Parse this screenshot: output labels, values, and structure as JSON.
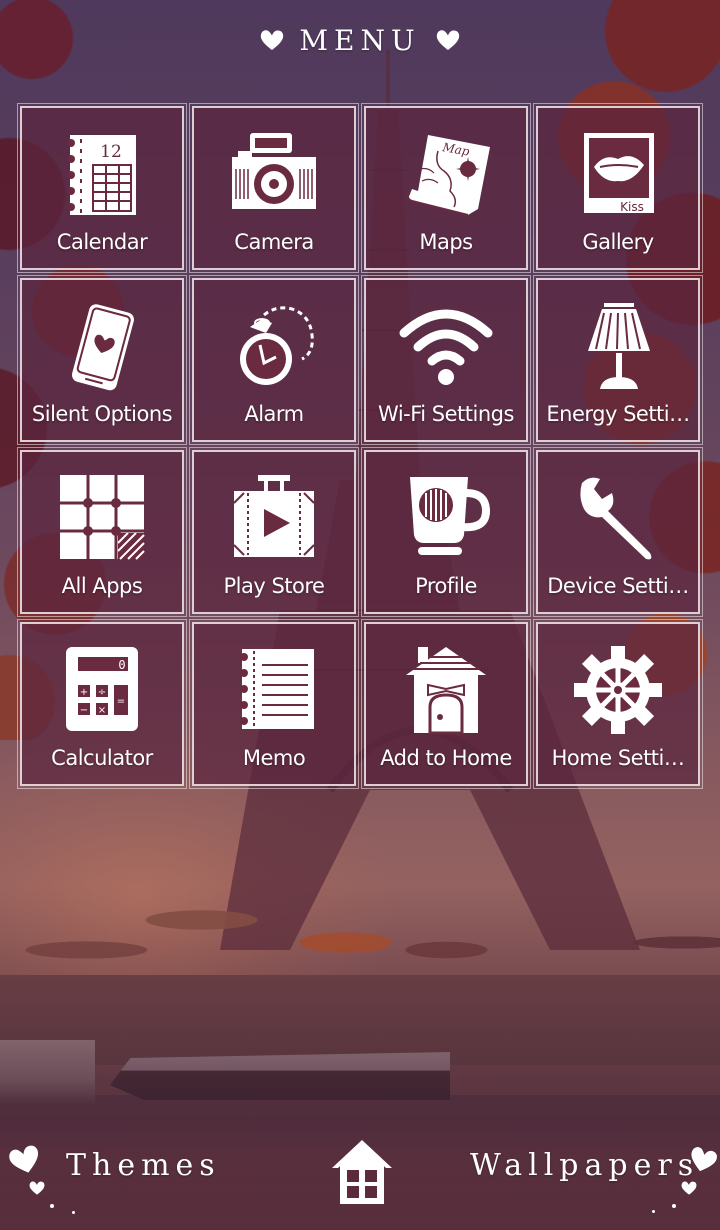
{
  "header": {
    "title": "MENU",
    "left_icon": "heart-icon",
    "right_icon": "heart-icon"
  },
  "grid": {
    "items": [
      {
        "label": "Calendar",
        "icon": "calendar-icon"
      },
      {
        "label": "Camera",
        "icon": "camera-icon"
      },
      {
        "label": "Maps",
        "icon": "map-scroll-icon",
        "icon_text": "Map"
      },
      {
        "label": "Gallery",
        "icon": "kiss-photo-icon",
        "icon_text": "Kiss"
      },
      {
        "label": "Silent Options",
        "icon": "phone-heart-icon"
      },
      {
        "label": "Alarm",
        "icon": "stopwatch-icon"
      },
      {
        "label": "Wi-Fi Settings",
        "icon": "wifi-icon"
      },
      {
        "label": "Energy Setti…",
        "icon": "lamp-icon"
      },
      {
        "label": "All Apps",
        "icon": "grid-apps-icon"
      },
      {
        "label": "Play Store",
        "icon": "suitcase-play-icon"
      },
      {
        "label": "Profile",
        "icon": "coffee-cup-icon"
      },
      {
        "label": "Device Setti…",
        "icon": "wrench-icon"
      },
      {
        "label": "Calculator",
        "icon": "calculator-icon",
        "icon_text": "0"
      },
      {
        "label": "Memo",
        "icon": "notepad-icon"
      },
      {
        "label": "Add to Home",
        "icon": "house-bow-icon"
      },
      {
        "label": "Home Setti…",
        "icon": "gear-icon"
      }
    ]
  },
  "calendar_icon_day": "12",
  "footer": {
    "themes_label": "Themes",
    "wallpapers_label": "Wallpapers",
    "home_icon": "home-icon"
  },
  "colors": {
    "tile_bg": "#5c263e",
    "tile_border": "#f5ebf0",
    "text": "#ffffff",
    "icon_dark": "#6a2a40"
  }
}
